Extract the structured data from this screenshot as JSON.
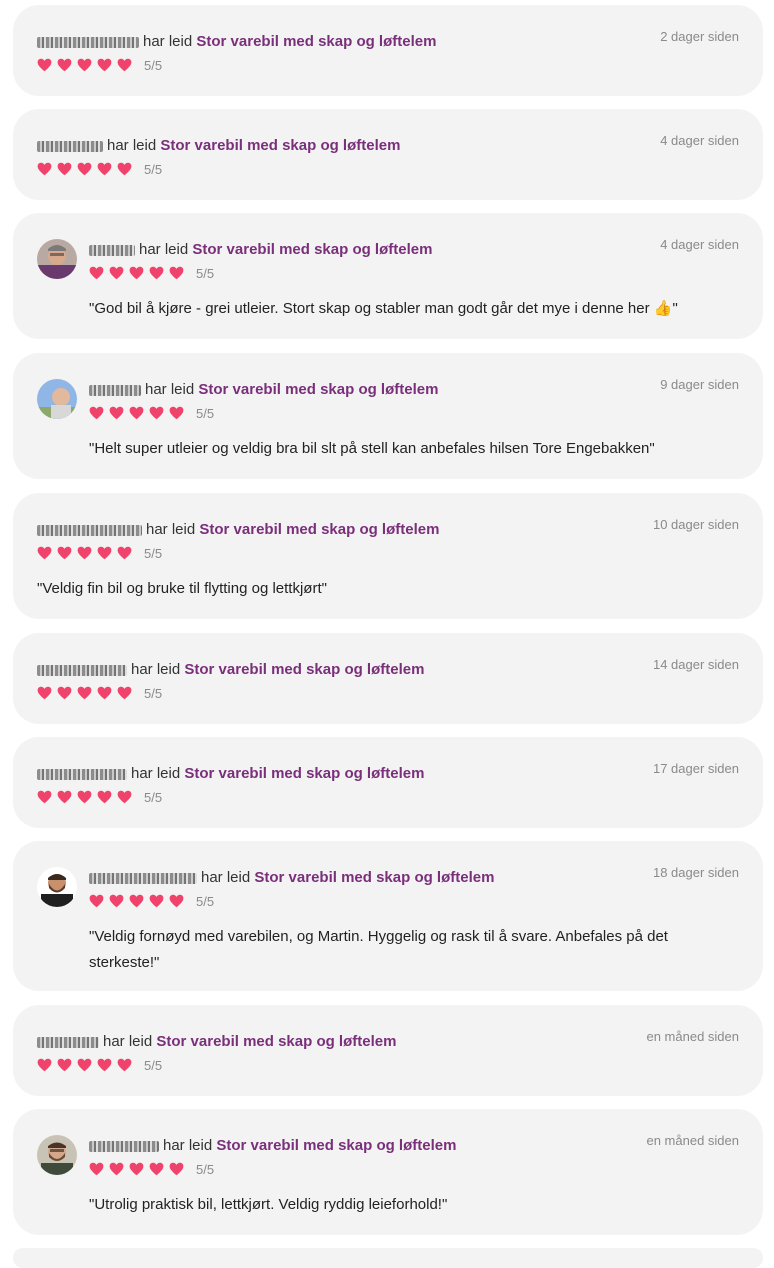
{
  "reviews": [
    {
      "verb": "har leid",
      "vehicle": "Stor varebil med skap og løftelem",
      "date": "2 dager siden",
      "score": "5/5",
      "rating": 5,
      "avatar": null,
      "comment": ""
    },
    {
      "verb": "har leid",
      "vehicle": "Stor varebil med skap og løftelem",
      "date": "4 dager siden",
      "score": "5/5",
      "rating": 5,
      "avatar": null,
      "comment": ""
    },
    {
      "verb": "har leid",
      "vehicle": "Stor varebil med skap og løftelem",
      "date": "4 dager siden",
      "score": "5/5",
      "rating": 5,
      "avatar": "man-glasses-purple",
      "comment": "\"God bil å kjøre - grei utleier. Stort skap og stabler man godt går det mye i denne her 👍\""
    },
    {
      "verb": "har leid",
      "vehicle": "Stor varebil med skap og løftelem",
      "date": "9 dager siden",
      "score": "5/5",
      "rating": 5,
      "avatar": "man-sky-background",
      "comment": "\"Helt super utleier og veldig bra bil slt på stell kan anbefales hilsen Tore Engebakken\""
    },
    {
      "verb": "har leid",
      "vehicle": "Stor varebil med skap og løftelem",
      "date": "10 dager siden",
      "score": "5/5",
      "rating": 5,
      "avatar": null,
      "comment": "\"Veldig fin bil og bruke til flytting og lettkjørt\""
    },
    {
      "verb": "har leid",
      "vehicle": "Stor varebil med skap og løftelem",
      "date": "14 dager siden",
      "score": "5/5",
      "rating": 5,
      "avatar": null,
      "comment": ""
    },
    {
      "verb": "har leid",
      "vehicle": "Stor varebil med skap og løftelem",
      "date": "17 dager siden",
      "score": "5/5",
      "rating": 5,
      "avatar": null,
      "comment": ""
    },
    {
      "verb": "har leid",
      "vehicle": "Stor varebil med skap og løftelem",
      "date": "18 dager siden",
      "score": "5/5",
      "rating": 5,
      "avatar": "man-beard-black-shirt",
      "comment": "\"Veldig fornøyd med varebilen, og Martin. Hyggelig og rask til å svare. Anbefales på det sterkeste!\""
    },
    {
      "verb": "har leid",
      "vehicle": "Stor varebil med skap og løftelem",
      "date": "en måned siden",
      "score": "5/5",
      "rating": 5,
      "avatar": null,
      "comment": ""
    },
    {
      "verb": "har leid",
      "vehicle": "Stor varebil med skap og løftelem",
      "date": "en måned siden",
      "score": "5/5",
      "rating": 5,
      "avatar": "man-glasses-beard",
      "comment": "\"Utrolig praktisk bil, lettkjørt. Veldig ryddig leieforhold!\""
    }
  ],
  "colors": {
    "heart": "#f0436b",
    "vehicle_link": "#7a2f7b",
    "card_bg": "#f3f3f3"
  }
}
